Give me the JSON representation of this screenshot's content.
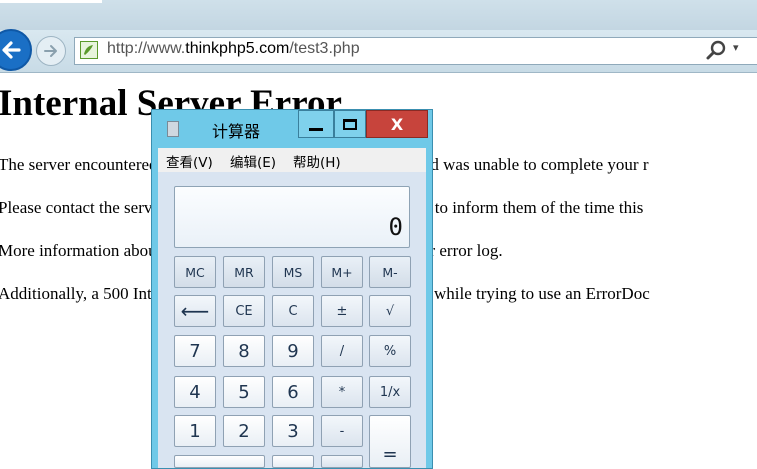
{
  "browser": {
    "url_prefix": "http://www.",
    "url_domain": "thinkphp5.com",
    "url_suffix": "/test3.php",
    "back_icon": "back-arrow-icon",
    "forward_icon": "forward-arrow-icon",
    "search_icon": "magnifier-icon",
    "dropdown_symbol": "▾"
  },
  "page": {
    "heading": "Internal Server Error",
    "paragraphs": [
      "The server encountered an internal error or misconfiguration and was unable to complete your r",
      "Please contact the server administrator at admin@example.com to inform them of the time this",
      "More information about this error may be available in the server error log.",
      "Additionally, a 500 Internal Server Error error was encountered while trying to use an ErrorDoc"
    ]
  },
  "calculator": {
    "title": "计算器",
    "close_label": "X",
    "menu": [
      "查看(V)",
      "编辑(E)",
      "帮助(H)"
    ],
    "display_value": "0",
    "memory_keys": [
      "MC",
      "MR",
      "MS",
      "M+",
      "M-"
    ],
    "row2_keys": [
      "⟵",
      "CE",
      "C",
      "±",
      "√"
    ],
    "row3_keys": [
      "7",
      "8",
      "9",
      "/",
      "%"
    ],
    "row4_keys": [
      "4",
      "5",
      "6",
      "*",
      "1/x"
    ],
    "row5_keys": [
      "1",
      "2",
      "3",
      "-",
      "="
    ],
    "colors": {
      "frame": "#6fc9e8",
      "close": "#c7443c",
      "body": "#d9e4f1"
    }
  }
}
